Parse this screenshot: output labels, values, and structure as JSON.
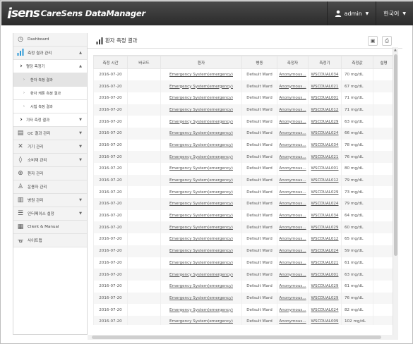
{
  "header": {
    "logo_i": "i",
    "logo_sens": "sens",
    "app_title": "CareSens DataManager",
    "user_label": "admin",
    "language_label": "한국어"
  },
  "sidebar": {
    "dashboard": "Dashboard",
    "patient_results": "측정 결과 관리",
    "glucose_meter": "혈당 측정기",
    "patient_measure_result": "환자 측정 결과",
    "patient_ketone_result": "환자 케톤 측정 결과",
    "control_result": "시험 측정 결과",
    "other_meter": "기타 측정 결과",
    "qc_results": "QC 결과 관리",
    "device_mgmt": "기기 관리",
    "consumables_mgmt": "소비재 관리",
    "patient_mgmt": "환자 관리",
    "operator_mgmt": "운용자 관리",
    "ward_mgmt": "병원 관리",
    "interface_settings": "인터페이스 설정",
    "client_manual": "Client & Manual",
    "sitemap": "사이트맵"
  },
  "main": {
    "title": "환자 측정 결과",
    "columns": [
      "측정 시간",
      "바코드",
      "환자",
      "병동",
      "측정자",
      "측정기",
      "측정값",
      "설명"
    ],
    "rows": [
      {
        "date": "2016-07-20",
        "barcode": "",
        "patient": "Emergency System(emergency)",
        "ward": "Default Ward",
        "operator": "Anonymous...",
        "meter": "WSCDUAL034",
        "value": "70 mg/dL",
        "note": ""
      },
      {
        "date": "2016-07-20",
        "barcode": "",
        "patient": "Emergency System(emergency)",
        "ward": "Default Ward",
        "operator": "Anonymous...",
        "meter": "WSCDUAL021",
        "value": "67 mg/dL",
        "note": ""
      },
      {
        "date": "2016-07-20",
        "barcode": "",
        "patient": "Emergency System(emergency)",
        "ward": "Default Ward",
        "operator": "Anonymous...",
        "meter": "WSCDUAL001",
        "value": "71 mg/dL",
        "note": ""
      },
      {
        "date": "2016-07-20",
        "barcode": "",
        "patient": "Emergency System(emergency)",
        "ward": "Default Ward",
        "operator": "Anonymous...",
        "meter": "WSCDUAL012",
        "value": "71 mg/dL",
        "note": ""
      },
      {
        "date": "2016-07-20",
        "barcode": "",
        "patient": "Emergency System(emergency)",
        "ward": "Default Ward",
        "operator": "Anonymous...",
        "meter": "WSCDUAL029",
        "value": "63 mg/dL",
        "note": ""
      },
      {
        "date": "2016-07-20",
        "barcode": "",
        "patient": "Emergency System(emergency)",
        "ward": "Default Ward",
        "operator": "Anonymous...",
        "meter": "WSCDUAL024",
        "value": "66 mg/dL",
        "note": ""
      },
      {
        "date": "2016-07-20",
        "barcode": "",
        "patient": "Emergency System(emergency)",
        "ward": "Default Ward",
        "operator": "Anonymous...",
        "meter": "WSCDUAL034",
        "value": "78 mg/dL",
        "note": ""
      },
      {
        "date": "2016-07-20",
        "barcode": "",
        "patient": "Emergency System(emergency)",
        "ward": "Default Ward",
        "operator": "Anonymous...",
        "meter": "WSCDUAL021",
        "value": "76 mg/dL",
        "note": ""
      },
      {
        "date": "2016-07-20",
        "barcode": "",
        "patient": "Emergency System(emergency)",
        "ward": "Default Ward",
        "operator": "Anonymous...",
        "meter": "WSCDUAL001",
        "value": "80 mg/dL",
        "note": ""
      },
      {
        "date": "2016-07-20",
        "barcode": "",
        "patient": "Emergency System(emergency)",
        "ward": "Default Ward",
        "operator": "Anonymous...",
        "meter": "WSCDUAL012",
        "value": "79 mg/dL",
        "note": ""
      },
      {
        "date": "2016-07-20",
        "barcode": "",
        "patient": "Emergency System(emergency)",
        "ward": "Default Ward",
        "operator": "Anonymous...",
        "meter": "WSCDUAL029",
        "value": "73 mg/dL",
        "note": ""
      },
      {
        "date": "2016-07-20",
        "barcode": "",
        "patient": "Emergency System(emergency)",
        "ward": "Default Ward",
        "operator": "Anonymous...",
        "meter": "WSCDUAL024",
        "value": "79 mg/dL",
        "note": ""
      },
      {
        "date": "2016-07-20",
        "barcode": "",
        "patient": "Emergency System(emergency)",
        "ward": "Default Ward",
        "operator": "Anonymous...",
        "meter": "WSCDUAL034",
        "value": "64 mg/dL",
        "note": ""
      },
      {
        "date": "2016-07-20",
        "barcode": "",
        "patient": "Emergency System(emergency)",
        "ward": "Default Ward",
        "operator": "Anonymous...",
        "meter": "WSCDUAL029",
        "value": "60 mg/dL",
        "note": ""
      },
      {
        "date": "2016-07-20",
        "barcode": "",
        "patient": "Emergency System(emergency)",
        "ward": "Default Ward",
        "operator": "Anonymous...",
        "meter": "WSCDUAL012",
        "value": "65 mg/dL",
        "note": ""
      },
      {
        "date": "2016-07-20",
        "barcode": "",
        "patient": "Emergency System(emergency)",
        "ward": "Default Ward",
        "operator": "Anonymous...",
        "meter": "WSCDUAL024",
        "value": "59 mg/dL",
        "note": ""
      },
      {
        "date": "2016-07-20",
        "barcode": "",
        "patient": "Emergency System(emergency)",
        "ward": "Default Ward",
        "operator": "Anonymous...",
        "meter": "WSCDUAL021",
        "value": "61 mg/dL",
        "note": ""
      },
      {
        "date": "2016-07-20",
        "barcode": "",
        "patient": "Emergency System(emergency)",
        "ward": "Default Ward",
        "operator": "Anonymous...",
        "meter": "WSCDUAL001",
        "value": "63 mg/dL",
        "note": ""
      },
      {
        "date": "2016-07-20",
        "barcode": "",
        "patient": "Emergency System(emergency)",
        "ward": "Default Ward",
        "operator": "Anonymous...",
        "meter": "WSCDUAL029",
        "value": "61 mg/dL",
        "note": ""
      },
      {
        "date": "2016-07-20",
        "barcode": "",
        "patient": "Emergency System(emergency)",
        "ward": "Default Ward",
        "operator": "Anonymous...",
        "meter": "WSCDUAL029",
        "value": "76 mg/dL",
        "note": ""
      },
      {
        "date": "2016-07-20",
        "barcode": "",
        "patient": "Emergency System(emergency)",
        "ward": "Default Ward",
        "operator": "Anonymous...",
        "meter": "WSCDUAL024",
        "value": "82 mg/dL",
        "note": ""
      },
      {
        "date": "2016-07-20",
        "barcode": "",
        "patient": "Emergency System(emergency)",
        "ward": "Default Ward",
        "operator": "Anonymous...",
        "meter": "WSCDUAL009",
        "value": "102 mg/dL",
        "note": ""
      },
      {
        "date": "2016-07-20",
        "barcode": "",
        "patient": "Emergency System(emergency)",
        "ward": "Default Ward",
        "operator": "Anonymous...",
        "meter": "WSCDUAL010",
        "value": "100 mg/dL",
        "note": ""
      }
    ]
  },
  "colors": {
    "topbar": "#333333",
    "accent": "#2e9ad7",
    "logo_dot": "#30b8ff"
  },
  "icons": {
    "dashboard": "clock-icon",
    "results": "bar-chart-icon",
    "qc": "clipboard-icon",
    "device": "tools-icon",
    "consumables": "drop-icon",
    "patient": "plus-circle-icon",
    "operator": "person-icon",
    "ward": "hospital-icon",
    "interface": "sliders-icon",
    "client": "document-icon",
    "sitemap": "sitemap-icon",
    "excel": "excel-icon",
    "print": "print-icon"
  }
}
